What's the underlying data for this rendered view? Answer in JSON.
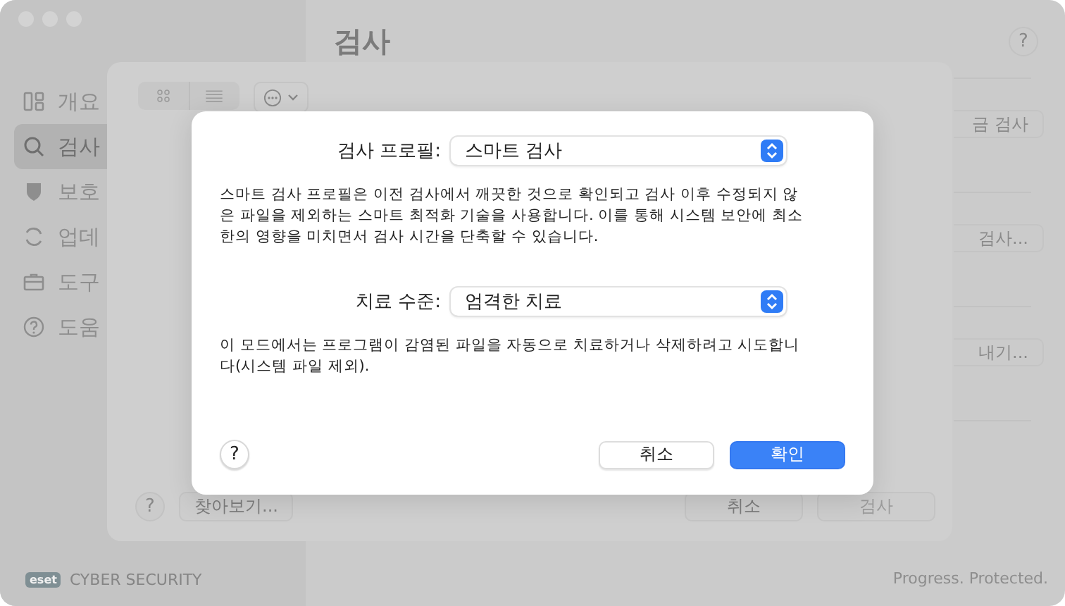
{
  "window": {
    "title": "검사",
    "help": "?"
  },
  "sidebar": {
    "items": [
      {
        "label": "개요",
        "selected": false
      },
      {
        "label": "검사",
        "selected": true
      },
      {
        "label": "보호",
        "selected": false
      },
      {
        "label": "업데",
        "selected": false
      },
      {
        "label": "도구",
        "selected": false
      },
      {
        "label": "도움",
        "selected": false
      }
    ],
    "logo": "eset",
    "product": "CYBER SECURITY"
  },
  "main": {
    "side_buttons": [
      "금 검사",
      "검사...",
      "내기..."
    ],
    "slogan": "Progress. Protected."
  },
  "scan_sheet": {
    "help": "?",
    "browse": "찾아보기...",
    "actions": [
      {
        "label": "취소",
        "disabled": false
      },
      {
        "label": "검사",
        "disabled": true
      }
    ]
  },
  "dialog": {
    "settings": [
      {
        "label": "검사 프로필:",
        "value": "스마트 검사",
        "description": "스마트 검사 프로필은 이전 검사에서 깨끗한 것으로 확인되고 검사 이후 수정되지 않은 파일을 제외하는 스마트 최적화 기술을 사용합니다. 이를 통해 시스템 보안에 최소한의 영향을 미치면서 검사 시간을 단축할 수 있습니다."
      },
      {
        "label": "치료 수준:",
        "value": "엄격한 치료",
        "description": "이 모드에서는 프로그램이 감염된 파일을 자동으로 치료하거나 삭제하려고 시도합니다(시스템 파일 제외)."
      }
    ],
    "help": "?",
    "buttons": [
      {
        "label": "취소",
        "kind": "secondary"
      },
      {
        "label": "확인",
        "kind": "primary"
      }
    ]
  }
}
